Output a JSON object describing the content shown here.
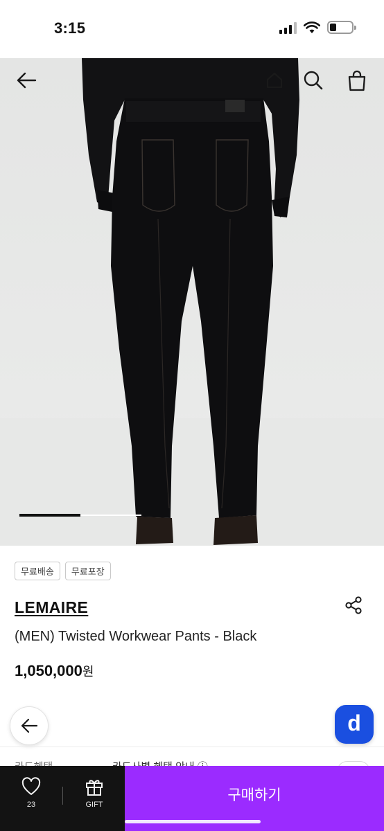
{
  "status": {
    "time": "3:15"
  },
  "hero": {
    "image_alt": "LEMAIRE Twisted Workwear Pants",
    "slide_progress": 0.5
  },
  "top_nav": {
    "back_icon": "arrow-left-icon",
    "home_icon": "home-icon",
    "search_icon": "search-icon",
    "bag_icon": "shopping-bag-icon"
  },
  "product": {
    "badges": [
      "무료배송",
      "무료포장"
    ],
    "brand": "LEMAIRE",
    "name": "(MEN) Twisted Workwear Pants - Black",
    "price": "1,050,000",
    "currency": "원"
  },
  "card_benefit": {
    "label": "카드혜택",
    "value": "카드사별 혜택 안내 ⓘ"
  },
  "floating": {
    "app_badge_label": "d"
  },
  "bottom_bar": {
    "like_count": "23",
    "gift_label": "GIFT",
    "buy_label": "구매하기"
  },
  "colors": {
    "buy_button": "#9b2bff",
    "bottom_left": "#131313",
    "app_badge": "#1a4fe0"
  }
}
